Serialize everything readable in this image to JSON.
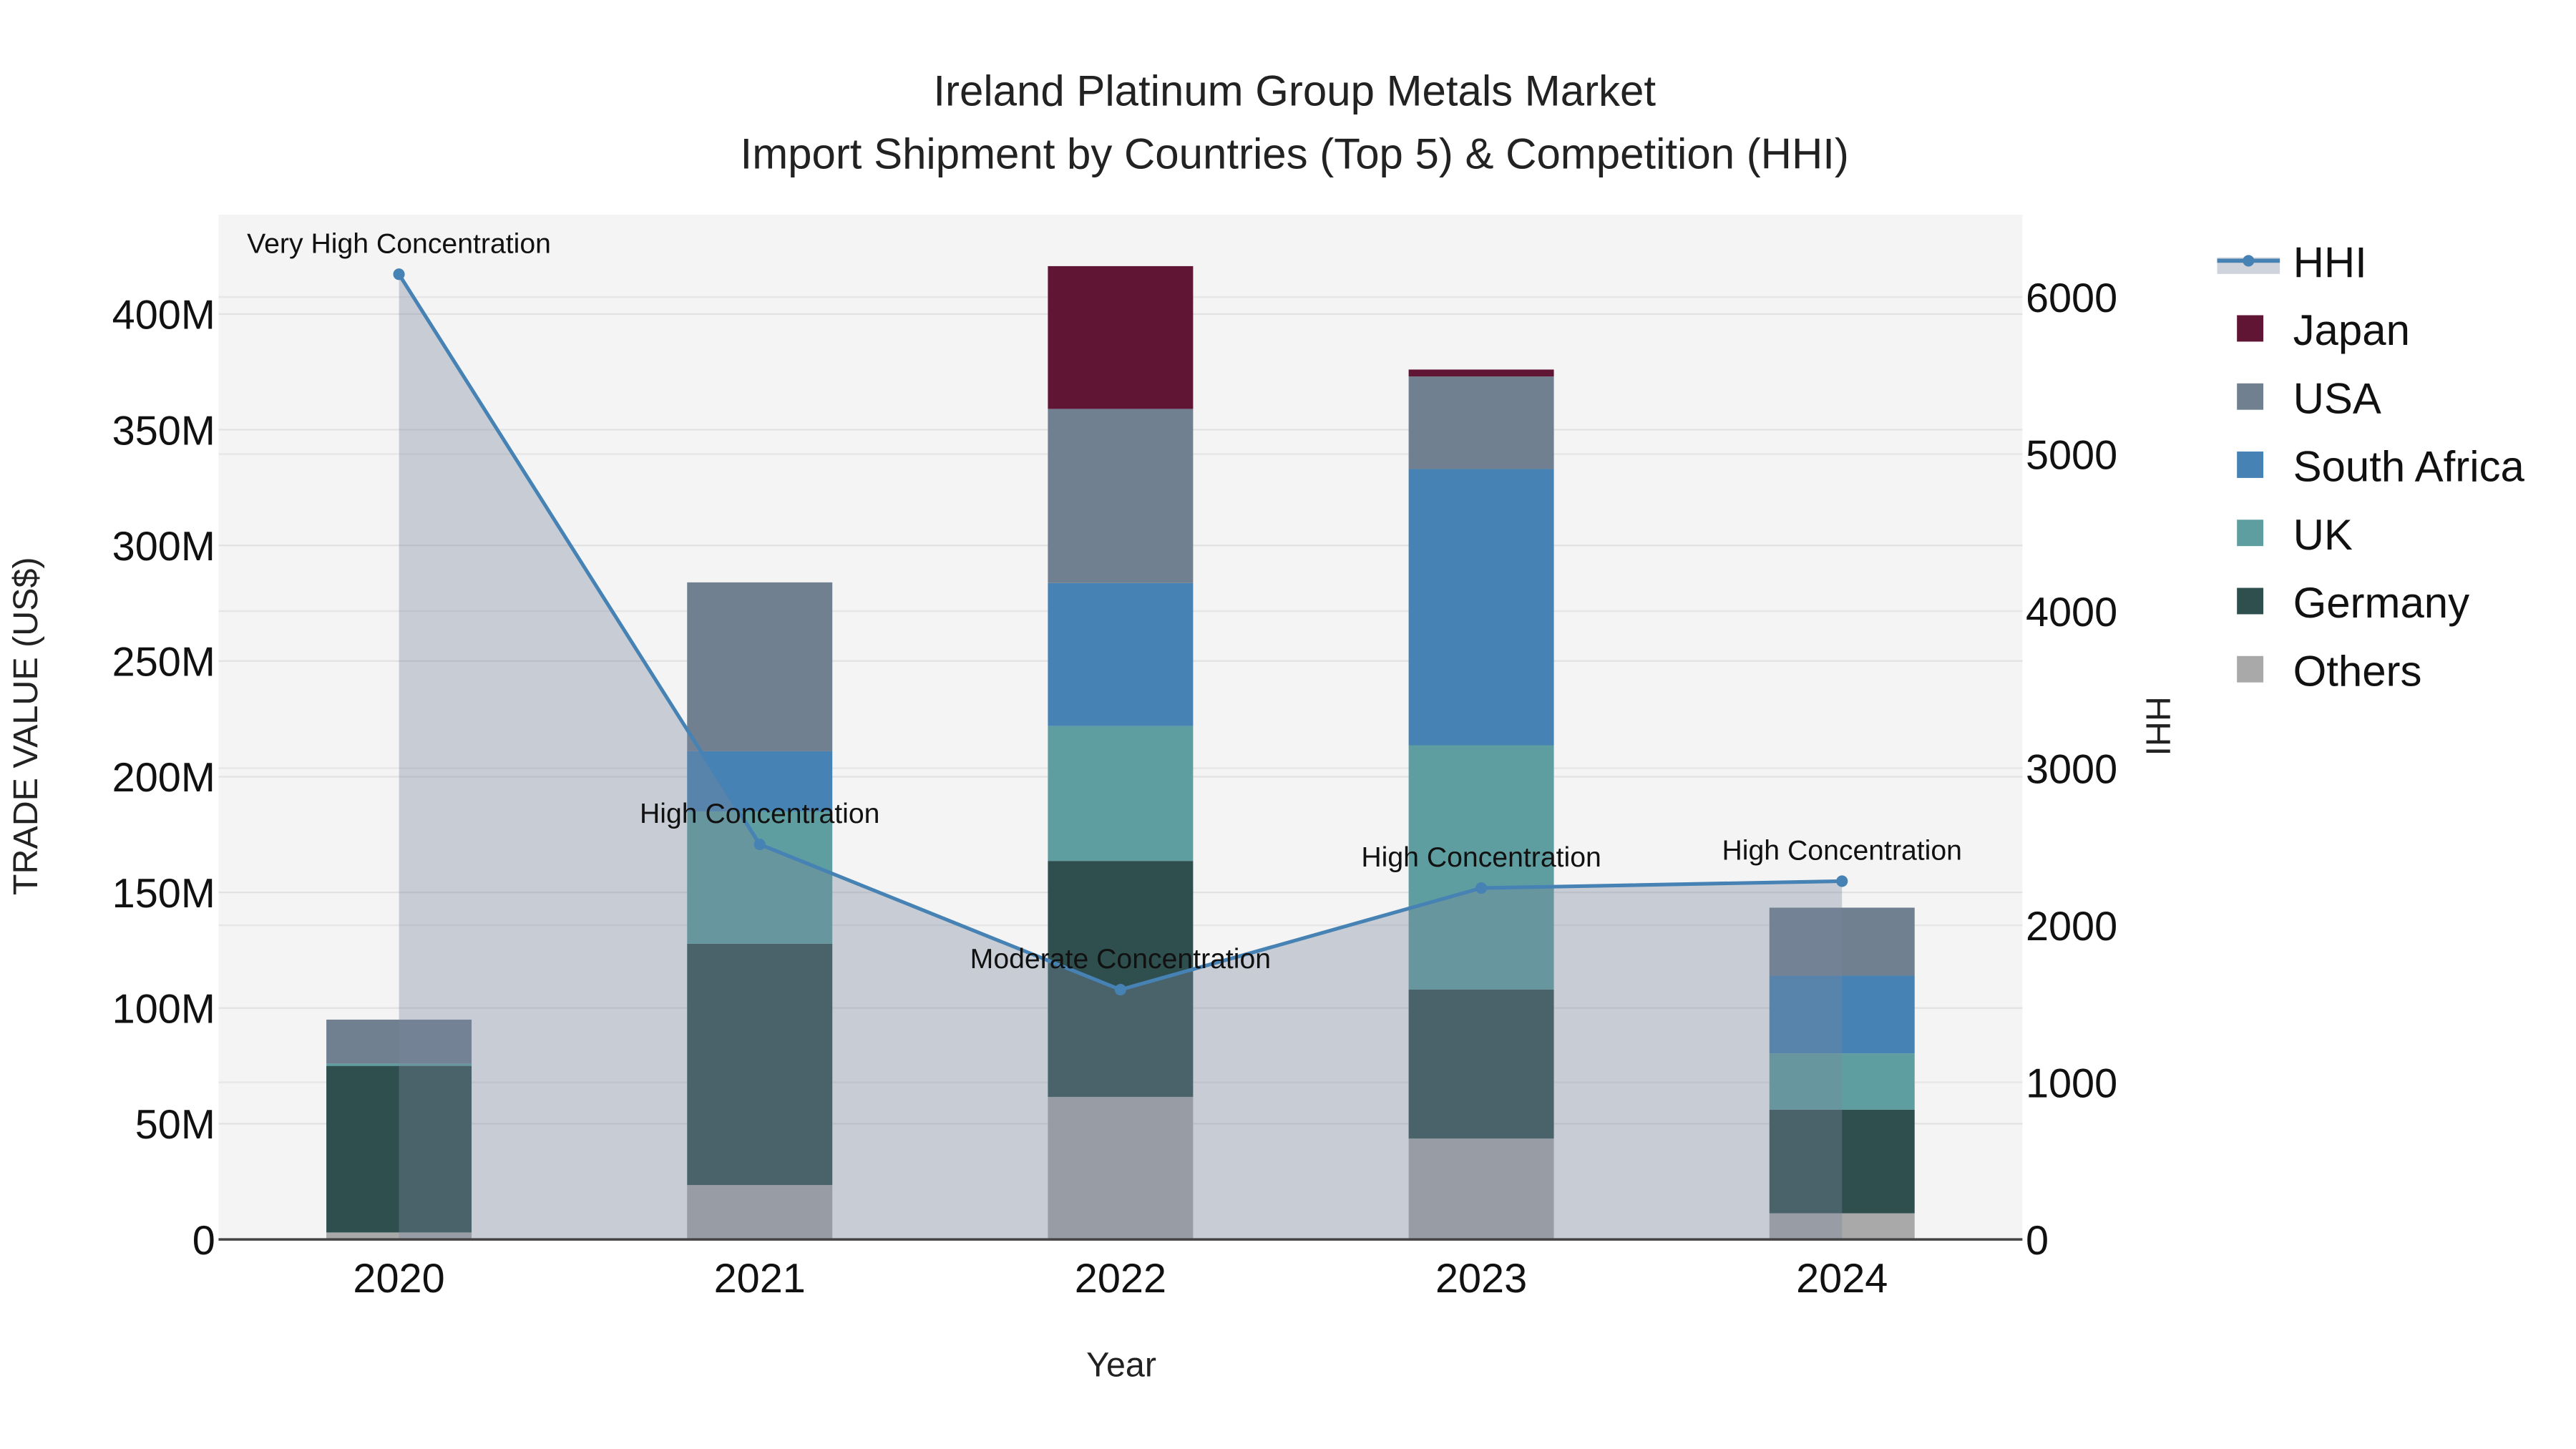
{
  "chart_data": {
    "type": "bar",
    "title_line1": "Ireland Platinum Group Metals Market",
    "title_line2": "Import Shipment by Countries (Top 5) & Competition (HHI)",
    "xlabel": "Year",
    "ylabel": "TRADE VALUE (US$)",
    "y2label": "HHI",
    "categories": [
      "2020",
      "2021",
      "2022",
      "2023",
      "2024"
    ],
    "ylim": [
      0,
      443
    ],
    "y2lim": [
      0,
      6525
    ],
    "yticks": [
      0,
      50,
      100,
      150,
      200,
      250,
      300,
      350,
      400
    ],
    "ytick_labels": [
      "0",
      "50M",
      "100M",
      "150M",
      "200M",
      "250M",
      "300M",
      "350M",
      "400M"
    ],
    "y2ticks": [
      0,
      1000,
      2000,
      3000,
      4000,
      5000,
      6000
    ],
    "y2tick_labels": [
      "0",
      "1000",
      "2000",
      "3000",
      "4000",
      "5000",
      "6000"
    ],
    "units": "million US$",
    "series": [
      {
        "name": "Others",
        "color": "#a9a9a9",
        "values": [
          3,
          23.5,
          61.6,
          43.6,
          11.3
        ]
      },
      {
        "name": "Germany",
        "color": "#2f4f4f",
        "values": [
          72,
          104.3,
          102,
          64.4,
          44.8
        ]
      },
      {
        "name": "UK",
        "color": "#5f9ea0",
        "values": [
          1,
          57.2,
          58.3,
          105.6,
          24.3
        ]
      },
      {
        "name": "South Africa",
        "color": "#4682b4",
        "values": [
          0,
          26,
          61.8,
          119.4,
          33.6
        ]
      },
      {
        "name": "USA",
        "color": "#708090",
        "values": [
          19,
          73,
          75.3,
          40,
          29.4
        ]
      },
      {
        "name": "Japan",
        "color": "#611535",
        "values": [
          0,
          0,
          61.7,
          3,
          0
        ]
      }
    ],
    "hhi": {
      "name": "HHI",
      "color": "#4682b4",
      "values": [
        6145,
        2515,
        1590,
        2237,
        2281
      ],
      "annotations": [
        "Very High Concentration",
        "High Concentration",
        "Moderate Concentration",
        "High Concentration",
        "High Concentration"
      ]
    },
    "legend_position": "right",
    "legend_order": [
      "HHI",
      "Japan",
      "USA",
      "South Africa",
      "UK",
      "Germany",
      "Others"
    ],
    "grid": true
  }
}
